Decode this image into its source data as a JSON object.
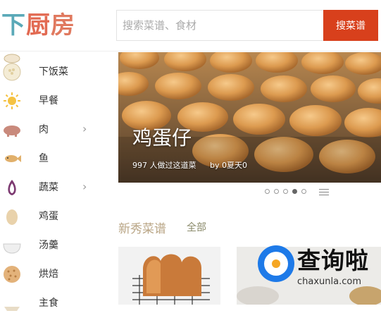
{
  "header": {
    "logo": {
      "part1": "下",
      "part2": "厨",
      "part3": "房"
    },
    "search": {
      "placeholder": "搜索菜谱、食材",
      "value": ""
    },
    "search_button_label": "搜菜谱"
  },
  "sidebar": {
    "items": [
      {
        "label": "下饭菜",
        "icon": "rice-bowl-icon",
        "has_submenu": false
      },
      {
        "label": "早餐",
        "icon": "sun-icon",
        "has_submenu": false
      },
      {
        "label": "肉",
        "icon": "pig-icon",
        "has_submenu": true
      },
      {
        "label": "鱼",
        "icon": "fish-icon",
        "has_submenu": false
      },
      {
        "label": "蔬菜",
        "icon": "onion-icon",
        "has_submenu": true
      },
      {
        "label": "鸡蛋",
        "icon": "egg-icon",
        "has_submenu": false
      },
      {
        "label": "汤羹",
        "icon": "soup-bowl-icon",
        "has_submenu": false
      },
      {
        "label": "烘焙",
        "icon": "cookie-icon",
        "has_submenu": false
      },
      {
        "label": "主食",
        "icon": "staple-food-icon",
        "has_submenu": false
      }
    ],
    "chevron": "›"
  },
  "banner": {
    "title": "鸡蛋仔",
    "count_text": "997 人做过这道菜",
    "author_text": "by 0夏天0",
    "slides": 5,
    "active_slide": 4
  },
  "section": {
    "title": "新秀菜谱",
    "all_label": "全部"
  },
  "watermark": {
    "text": "查询啦",
    "url": "chaxunla.com"
  },
  "colors": {
    "accent": "#d8401c",
    "logo_teal": "#5aa9b8",
    "logo_red": "#e26a52",
    "section_title": "#b9a585"
  }
}
